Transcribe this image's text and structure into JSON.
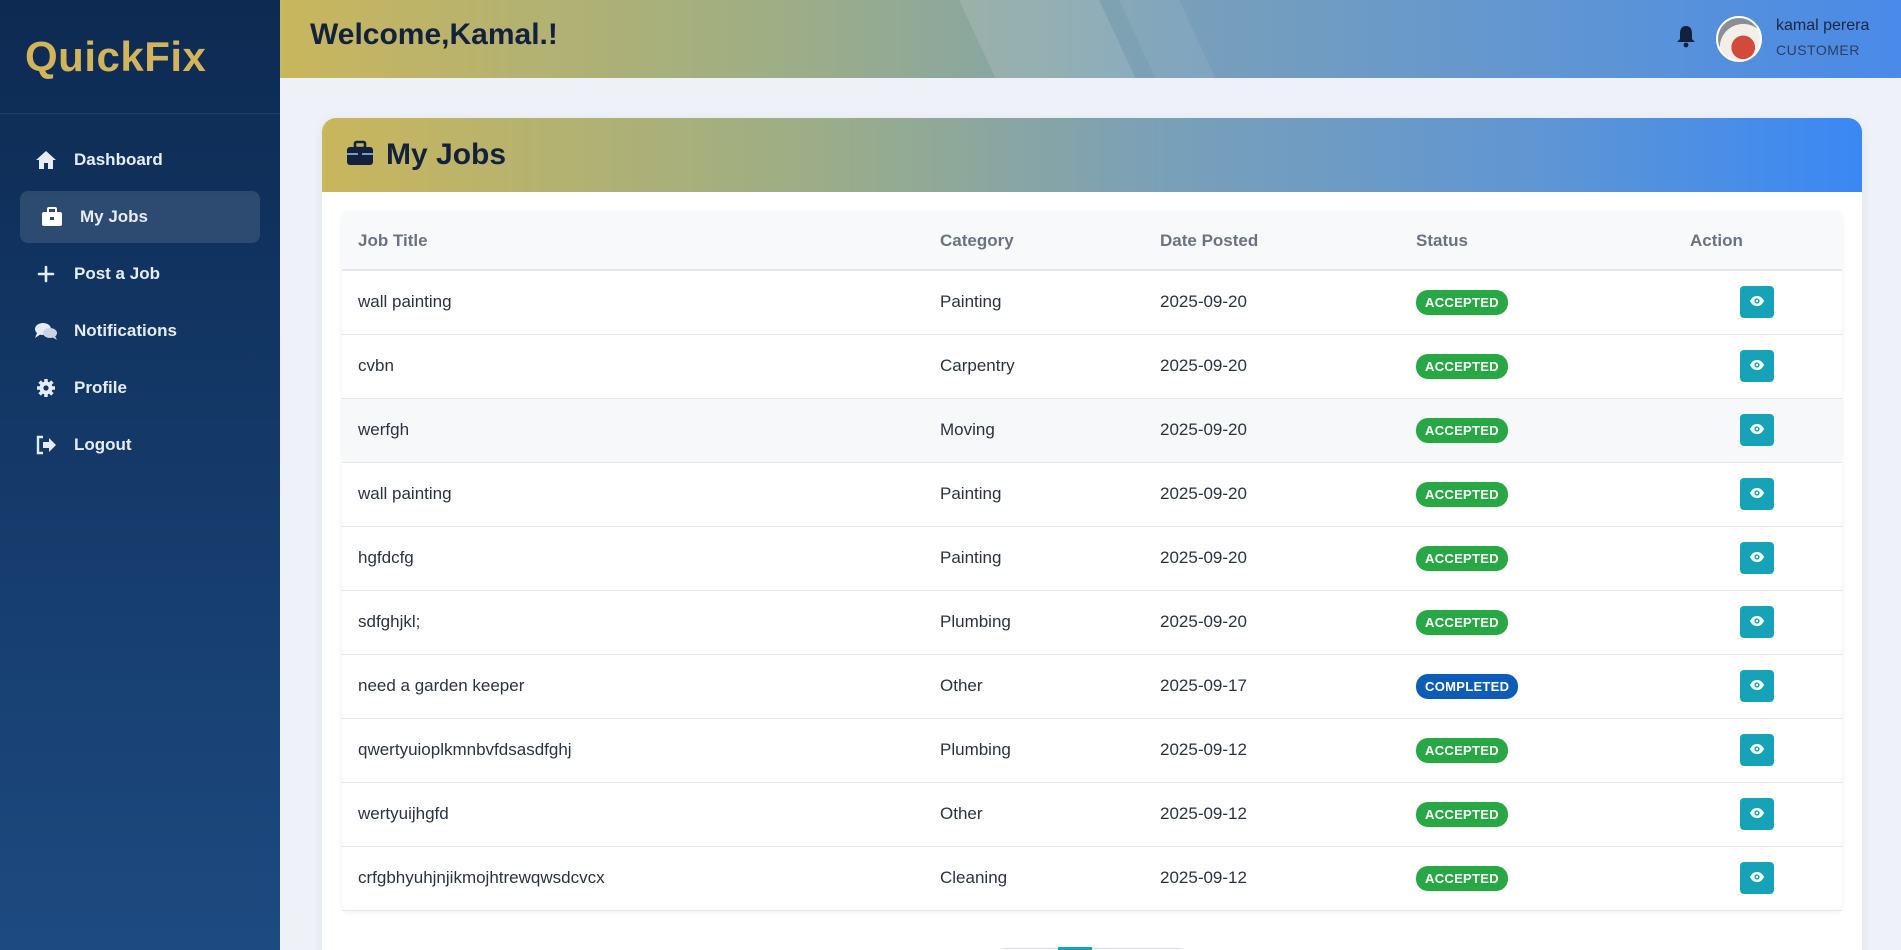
{
  "brand": {
    "name": "QuickFix",
    "color": "#d2b45a"
  },
  "sidebar": {
    "items": [
      {
        "label": "Dashboard",
        "icon": "home-icon",
        "active": false
      },
      {
        "label": "My Jobs",
        "icon": "briefcase-icon",
        "active": true
      },
      {
        "label": "Post a Job",
        "icon": "plus-icon",
        "active": false
      },
      {
        "label": "Notifications",
        "icon": "comments-icon",
        "active": false
      },
      {
        "label": "Profile",
        "icon": "gear-icon",
        "active": false
      },
      {
        "label": "Logout",
        "icon": "logout-icon",
        "active": false
      }
    ]
  },
  "header": {
    "welcome": "Welcome,Kamal.!",
    "user": {
      "name": "kamal perera",
      "role": "CUSTOMER"
    }
  },
  "main": {
    "title": "My Jobs",
    "columns": [
      "Job Title",
      "Category",
      "Date Posted",
      "Status",
      "Action"
    ],
    "rows": [
      {
        "title": "wall painting",
        "category": "Painting",
        "date": "2025-09-20",
        "status": "ACCEPTED"
      },
      {
        "title": "cvbn",
        "category": "Carpentry",
        "date": "2025-09-20",
        "status": "ACCEPTED"
      },
      {
        "title": "werfgh",
        "category": "Moving",
        "date": "2025-09-20",
        "status": "ACCEPTED"
      },
      {
        "title": "wall painting",
        "category": "Painting",
        "date": "2025-09-20",
        "status": "ACCEPTED"
      },
      {
        "title": "hgfdcfg",
        "category": "Painting",
        "date": "2025-09-20",
        "status": "ACCEPTED"
      },
      {
        "title": "sdfghjkl;",
        "category": "Plumbing",
        "date": "2025-09-20",
        "status": "ACCEPTED"
      },
      {
        "title": "need a garden keeper",
        "category": "Other",
        "date": "2025-09-17",
        "status": "COMPLETED"
      },
      {
        "title": "qwertyuioplkmnbvfdsasdfghj",
        "category": "Plumbing",
        "date": "2025-09-12",
        "status": "ACCEPTED"
      },
      {
        "title": "wertyuijhgfd",
        "category": "Other",
        "date": "2025-09-12",
        "status": "ACCEPTED"
      },
      {
        "title": "crfgbhyuhjnjikmojhtrewqwsdcvcx",
        "category": "Cleaning",
        "date": "2025-09-12",
        "status": "ACCEPTED"
      }
    ]
  },
  "colors": {
    "accepted": "#28a745",
    "completed": "#0d5cb6",
    "action": "#17a2b8"
  }
}
